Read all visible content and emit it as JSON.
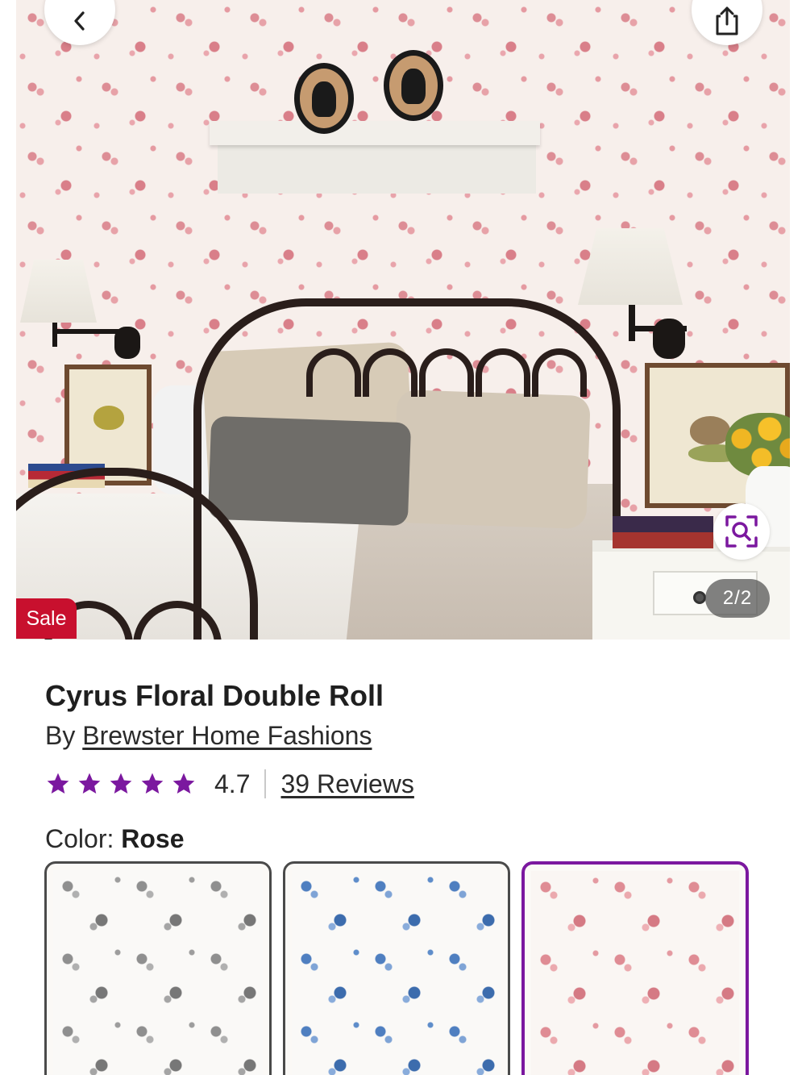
{
  "gallery": {
    "counter": "2/2",
    "sale_badge": "Sale"
  },
  "product": {
    "title": "Cyrus Floral Double Roll",
    "by_prefix": "By",
    "brand": "Brewster Home Fashions",
    "rating": "4.7",
    "rating_stars": 5,
    "reviews_link": "39 Reviews",
    "color_label": "Color:",
    "color_value": "Rose"
  },
  "swatches": [
    {
      "color": "#8f8f8f",
      "selected": false
    },
    {
      "color": "#4f7fc0",
      "selected": false
    },
    {
      "color": "#df8c94",
      "selected": true
    }
  ],
  "theme": {
    "accent": "#7b189f",
    "sale": "#c8102e"
  }
}
